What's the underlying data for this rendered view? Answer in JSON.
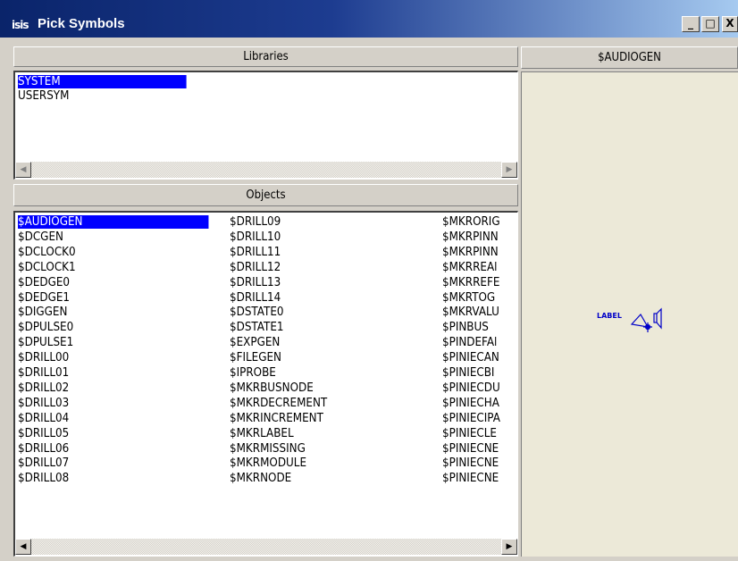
{
  "window": {
    "app_badge": "isis",
    "title": "Pick Symbols",
    "buttons": {
      "minimize": "_",
      "maximize": "□",
      "close": "X"
    }
  },
  "libraries": {
    "header": "Libraries",
    "items": [
      "SYSTEM",
      "USERSYM"
    ],
    "selected_index": 0
  },
  "objects": {
    "header": "Objects",
    "columns": [
      [
        "$AUDIOGEN",
        "$DCGEN",
        "$DCLOCK0",
        "$DCLOCK1",
        "$DEDGE0",
        "$DEDGE1",
        "$DIGGEN",
        "$DPULSE0",
        "$DPULSE1",
        "$DRILL00",
        "$DRILL01",
        "$DRILL02",
        "$DRILL03",
        "$DRILL04",
        "$DRILL05",
        "$DRILL06",
        "$DRILL07",
        "$DRILL08"
      ],
      [
        "$DRILL09",
        "$DRILL10",
        "$DRILL11",
        "$DRILL12",
        "$DRILL13",
        "$DRILL14",
        "$DSTATE0",
        "$DSTATE1",
        "$EXPGEN",
        "$FILEGEN",
        "$IPROBE",
        "$MKRBUSNODE",
        "$MKRDECREMENT",
        "$MKRINCREMENT",
        "$MKRLABEL",
        "$MKRMISSING",
        "$MKRMODULE",
        "$MKRNODE"
      ],
      [
        "$MKRORIG",
        "$MKRPINN",
        "$MKRPINN",
        "$MKRREAl",
        "$MKRREFE",
        "$MKRTOG",
        "$MKRVALU",
        "$PINBUS",
        "$PINDEFAl",
        "$PINIECAN",
        "$PINIECBI",
        "$PINIECDU",
        "$PINIECHA",
        "$PINIECIPA",
        "$PINIECLE",
        "$PINIECNE",
        "$PINIECNE",
        "$PINIECNE"
      ]
    ],
    "selected": "$AUDIOGEN"
  },
  "preview": {
    "header": "$AUDIOGEN",
    "symbol_label": "LABEL",
    "symbol_color": "#0000c8"
  },
  "colors": {
    "selection": "#0000ff",
    "titlebar_start": "#0a246a",
    "face": "#d4d0c8"
  }
}
